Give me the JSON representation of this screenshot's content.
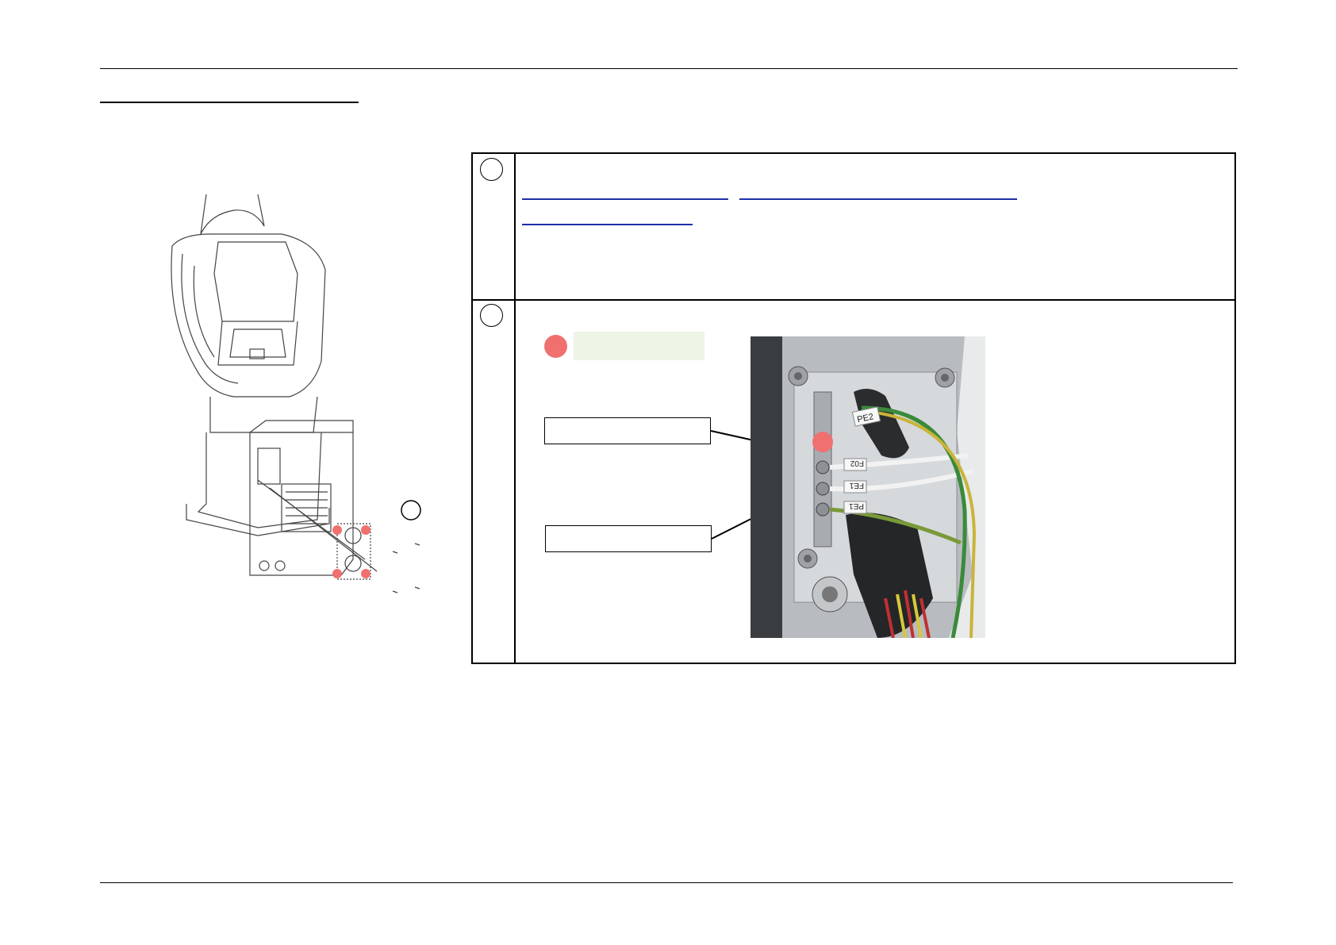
{
  "photo": {
    "labels": [
      "PE2",
      "F02",
      "FE1",
      "PE1"
    ]
  },
  "colors": {
    "marker": "#f07070",
    "link": "#1f2fa6",
    "legend_fill": "#eef4e6"
  }
}
